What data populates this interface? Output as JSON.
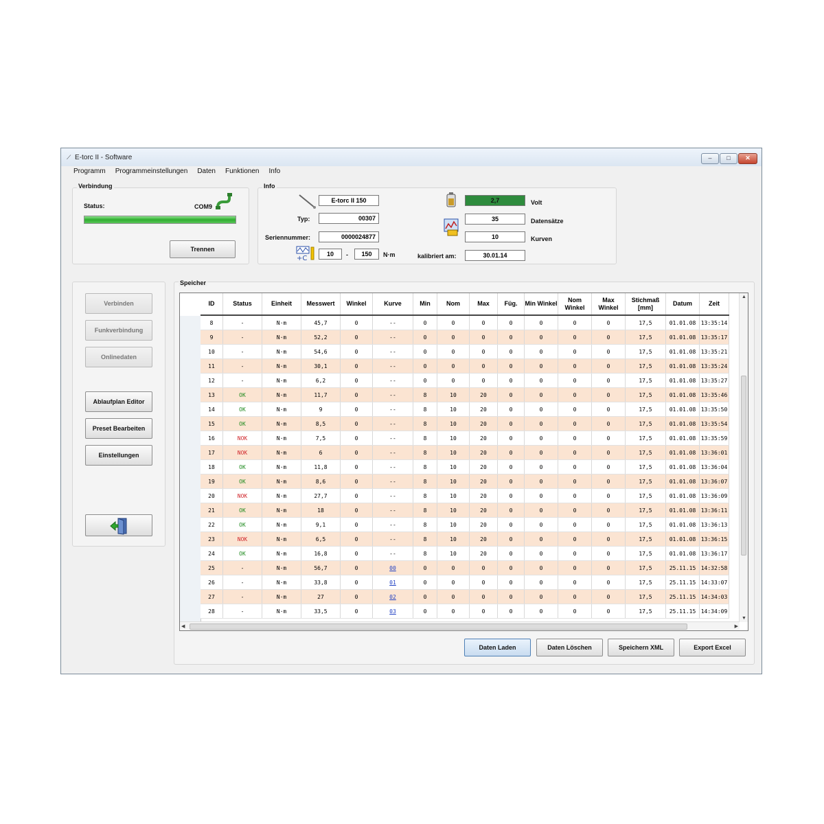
{
  "window": {
    "title": "E-torc II - Software"
  },
  "menu": [
    "Programm",
    "Programmeinstellungen",
    "Daten",
    "Funktionen",
    "Info"
  ],
  "connection": {
    "title": "Verbindung",
    "status_label": "Status:",
    "port": "COM9",
    "disconnect_button": "Trennen"
  },
  "info": {
    "title": "Info",
    "device": "E-torc II 150",
    "type_label": "Typ:",
    "type_value": "00307",
    "serial_label": "Seriennummer:",
    "serial_value": "0000024877",
    "range_min": "10",
    "range_sep": "-",
    "range_max": "150",
    "range_unit": "N·m",
    "voltage": "2,7",
    "voltage_label": "Volt",
    "records": "35",
    "records_label": "Datensätze",
    "curves": "10",
    "curves_label": "Kurven",
    "calibrated_label": "kalibriert am:",
    "calibrated_value": "30.01.14"
  },
  "sidebar": {
    "connect": "Verbinden",
    "radio": "Funkverbindung",
    "online": "Onlinedaten",
    "schedule_editor": "Ablaufplan Editor",
    "preset_edit": "Preset Bearbeiten",
    "settings": "Einstellungen"
  },
  "storage": {
    "title": "Speicher",
    "columns": [
      "ID",
      "Status",
      "Einheit",
      "Messwert",
      "Winkel",
      "Kurve",
      "Min",
      "Nom",
      "Max",
      "Füg.",
      "Min Winkel",
      "Nom Winkel",
      "Max Winkel",
      "Stichmaß [mm]",
      "Datum",
      "Zeit"
    ],
    "rows": [
      [
        "8",
        "-",
        "N·m",
        "45,7",
        "0",
        "--",
        "0",
        "0",
        "0",
        "0",
        "0",
        "0",
        "0",
        "17,5",
        "01.01.08",
        "13:35:14"
      ],
      [
        "9",
        "-",
        "N·m",
        "52,2",
        "0",
        "--",
        "0",
        "0",
        "0",
        "0",
        "0",
        "0",
        "0",
        "17,5",
        "01.01.08",
        "13:35:17"
      ],
      [
        "10",
        "-",
        "N·m",
        "54,6",
        "0",
        "--",
        "0",
        "0",
        "0",
        "0",
        "0",
        "0",
        "0",
        "17,5",
        "01.01.08",
        "13:35:21"
      ],
      [
        "11",
        "-",
        "N·m",
        "30,1",
        "0",
        "--",
        "0",
        "0",
        "0",
        "0",
        "0",
        "0",
        "0",
        "17,5",
        "01.01.08",
        "13:35:24"
      ],
      [
        "12",
        "-",
        "N·m",
        "6,2",
        "0",
        "--",
        "0",
        "0",
        "0",
        "0",
        "0",
        "0",
        "0",
        "17,5",
        "01.01.08",
        "13:35:27"
      ],
      [
        "13",
        "OK",
        "N·m",
        "11,7",
        "0",
        "--",
        "8",
        "10",
        "20",
        "0",
        "0",
        "0",
        "0",
        "17,5",
        "01.01.08",
        "13:35:46"
      ],
      [
        "14",
        "OK",
        "N·m",
        "9",
        "0",
        "--",
        "8",
        "10",
        "20",
        "0",
        "0",
        "0",
        "0",
        "17,5",
        "01.01.08",
        "13:35:50"
      ],
      [
        "15",
        "OK",
        "N·m",
        "8,5",
        "0",
        "--",
        "8",
        "10",
        "20",
        "0",
        "0",
        "0",
        "0",
        "17,5",
        "01.01.08",
        "13:35:54"
      ],
      [
        "16",
        "NOK",
        "N·m",
        "7,5",
        "0",
        "--",
        "8",
        "10",
        "20",
        "0",
        "0",
        "0",
        "0",
        "17,5",
        "01.01.08",
        "13:35:59"
      ],
      [
        "17",
        "NOK",
        "N·m",
        "6",
        "0",
        "--",
        "8",
        "10",
        "20",
        "0",
        "0",
        "0",
        "0",
        "17,5",
        "01.01.08",
        "13:36:01"
      ],
      [
        "18",
        "OK",
        "N·m",
        "11,8",
        "0",
        "--",
        "8",
        "10",
        "20",
        "0",
        "0",
        "0",
        "0",
        "17,5",
        "01.01.08",
        "13:36:04"
      ],
      [
        "19",
        "OK",
        "N·m",
        "8,6",
        "0",
        "--",
        "8",
        "10",
        "20",
        "0",
        "0",
        "0",
        "0",
        "17,5",
        "01.01.08",
        "13:36:07"
      ],
      [
        "20",
        "NOK",
        "N·m",
        "27,7",
        "0",
        "--",
        "8",
        "10",
        "20",
        "0",
        "0",
        "0",
        "0",
        "17,5",
        "01.01.08",
        "13:36:09"
      ],
      [
        "21",
        "OK",
        "N·m",
        "18",
        "0",
        "--",
        "8",
        "10",
        "20",
        "0",
        "0",
        "0",
        "0",
        "17,5",
        "01.01.08",
        "13:36:11"
      ],
      [
        "22",
        "OK",
        "N·m",
        "9,1",
        "0",
        "--",
        "8",
        "10",
        "20",
        "0",
        "0",
        "0",
        "0",
        "17,5",
        "01.01.08",
        "13:36:13"
      ],
      [
        "23",
        "NOK",
        "N·m",
        "6,5",
        "0",
        "--",
        "8",
        "10",
        "20",
        "0",
        "0",
        "0",
        "0",
        "17,5",
        "01.01.08",
        "13:36:15"
      ],
      [
        "24",
        "OK",
        "N·m",
        "16,8",
        "0",
        "--",
        "8",
        "10",
        "20",
        "0",
        "0",
        "0",
        "0",
        "17,5",
        "01.01.08",
        "13:36:17"
      ],
      [
        "25",
        "-",
        "N·m",
        "56,7",
        "0",
        "00",
        "0",
        "0",
        "0",
        "0",
        "0",
        "0",
        "0",
        "17,5",
        "25.11.15",
        "14:32:58"
      ],
      [
        "26",
        "-",
        "N·m",
        "33,8",
        "0",
        "01",
        "0",
        "0",
        "0",
        "0",
        "0",
        "0",
        "0",
        "17,5",
        "25.11.15",
        "14:33:07"
      ],
      [
        "27",
        "-",
        "N·m",
        "27",
        "0",
        "02",
        "0",
        "0",
        "0",
        "0",
        "0",
        "0",
        "0",
        "17,5",
        "25.11.15",
        "14:34:03"
      ],
      [
        "28",
        "-",
        "N·m",
        "33,5",
        "0",
        "03",
        "0",
        "0",
        "0",
        "0",
        "0",
        "0",
        "0",
        "17,5",
        "25.11.15",
        "14:34:09"
      ]
    ]
  },
  "actions": {
    "load": "Daten Laden",
    "delete": "Daten Löschen",
    "save_xml": "Speichern XML",
    "export_excel": "Export Excel"
  },
  "colors": {
    "row_highlight": "#fbe4d2",
    "ok": "#1e8a1e",
    "nok": "#d0262b",
    "battery_ok": "#2e8b3d",
    "status_bar": "#36b536"
  }
}
